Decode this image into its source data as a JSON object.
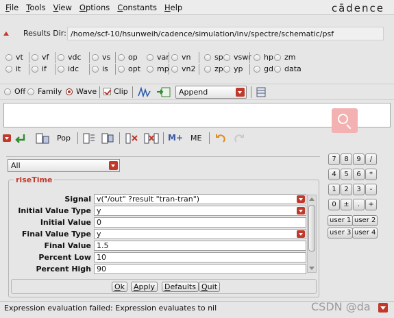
{
  "menu": [
    "File",
    "Tools",
    "View",
    "Options",
    "Constants",
    "Help"
  ],
  "brand": "cādence",
  "results": {
    "label": "Results Dir:",
    "path": "/home/scf-10/hsunweih/cadence/simulation/inv/spectre/schematic/psf"
  },
  "radios_row1": [
    "vt",
    "vf",
    "vdc",
    "vs",
    "op",
    "var",
    "vn",
    "sp",
    "vswr",
    "hp",
    "zm"
  ],
  "radios_row2": [
    "it",
    "if",
    "idc",
    "is",
    "opt",
    "mp",
    "vn2",
    "zp",
    "yp",
    "gd",
    "data"
  ],
  "plotmode": {
    "off": "Off",
    "family": "Family",
    "wave": "Wave",
    "clip": "Clip",
    "append": "Append"
  },
  "toolbar3": {
    "pop": "Pop",
    "mplus": "M+",
    "me": "ME"
  },
  "filter": {
    "selected": "All"
  },
  "function": {
    "title": "riseTime",
    "fields": [
      {
        "label": "Signal",
        "value": "v(\"/out\" ?result \"tran-tran\")"
      },
      {
        "label": "Initial Value Type",
        "value": "y"
      },
      {
        "label": "Initial Value",
        "value": "0"
      },
      {
        "label": "Final Value Type",
        "value": "y"
      },
      {
        "label": "Final Value",
        "value": "1.5"
      },
      {
        "label": "Percent Low",
        "value": "10"
      },
      {
        "label": "Percent High",
        "value": "90"
      }
    ],
    "buttons": {
      "ok": "Ok",
      "apply": "Apply",
      "defaults": "Defaults",
      "quit": "Quit"
    }
  },
  "keypad": {
    "rows": [
      [
        "7",
        "8",
        "9",
        "/"
      ],
      [
        "4",
        "5",
        "6",
        "*"
      ],
      [
        "1",
        "2",
        "3",
        "-"
      ],
      [
        "0",
        "±",
        ".",
        "+"
      ]
    ],
    "user": [
      "user 1",
      "user 2",
      "user 3",
      "user 4"
    ]
  },
  "status": "Expression evaluation failed: Expression evaluates to nil",
  "watermark": "CSDN @da",
  "colors": {
    "accent": "#c0392b"
  }
}
